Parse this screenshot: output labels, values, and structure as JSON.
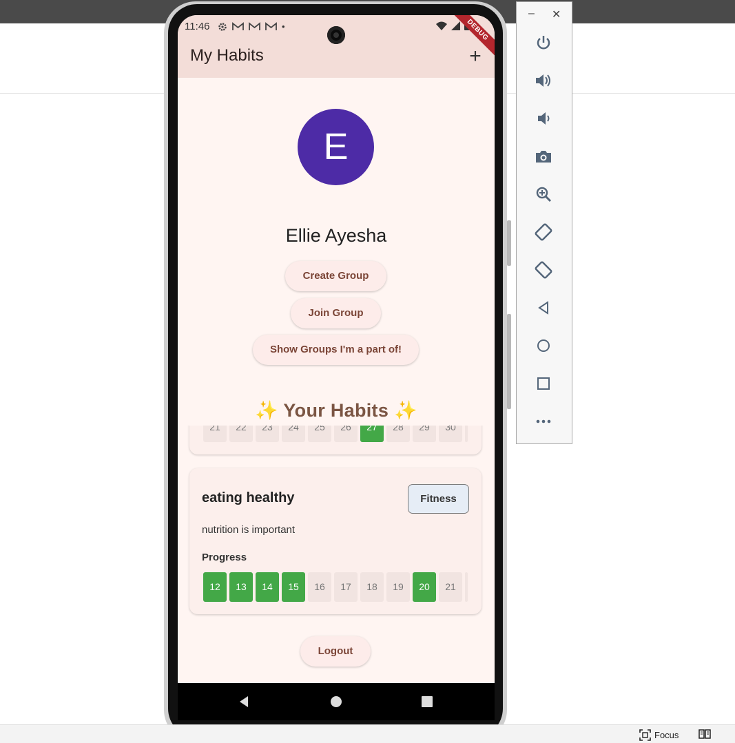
{
  "app": {
    "status_time": "11:46",
    "status_dot": "•",
    "debug_label": "DEBUG",
    "title": "My Habits",
    "add_icon": "+",
    "avatar_letter": "E",
    "user_name": "Ellie Ayesha",
    "buttons": {
      "create_group": "Create Group",
      "join_group": "Join Group",
      "show_groups": "Show Groups I'm a part of!",
      "logout": "Logout"
    },
    "habits_heading": "Your Habits",
    "habits": [
      {
        "days": [
          {
            "label": "21",
            "done": false
          },
          {
            "label": "22",
            "done": false
          },
          {
            "label": "23",
            "done": false
          },
          {
            "label": "24",
            "done": false
          },
          {
            "label": "25",
            "done": false
          },
          {
            "label": "26",
            "done": false
          },
          {
            "label": "27",
            "done": true
          },
          {
            "label": "28",
            "done": false
          },
          {
            "label": "29",
            "done": false
          },
          {
            "label": "30",
            "done": false
          }
        ]
      },
      {
        "title": "eating healthy",
        "category": "Fitness",
        "description": "nutrition is important",
        "progress_label": "Progress",
        "days": [
          {
            "label": "12",
            "done": true
          },
          {
            "label": "13",
            "done": true
          },
          {
            "label": "14",
            "done": true
          },
          {
            "label": "15",
            "done": true
          },
          {
            "label": "16",
            "done": false
          },
          {
            "label": "17",
            "done": false
          },
          {
            "label": "18",
            "done": false
          },
          {
            "label": "19",
            "done": false
          },
          {
            "label": "20",
            "done": true
          },
          {
            "label": "21",
            "done": false
          }
        ]
      }
    ]
  },
  "colors": {
    "appbar": "#f3ddd8",
    "background": "#fff5f2",
    "avatar": "#4d2ba6",
    "done_day": "#43a847",
    "heading": "#7b5543",
    "button_text": "#7b4537"
  },
  "icons": {
    "status": [
      "settings-icon",
      "gmail-icon",
      "gmail-icon",
      "gmail-icon"
    ],
    "status_right": [
      "wifi-icon",
      "signal-icon",
      "battery-icon"
    ],
    "nav": [
      "back-icon",
      "home-icon",
      "recents-icon"
    ],
    "toolbar": [
      "power-icon",
      "volume-up-icon",
      "volume-down-icon",
      "camera-icon",
      "zoom-icon",
      "rotate-left-icon",
      "rotate-right-icon",
      "back-icon",
      "home-icon",
      "overview-icon",
      "more-icon"
    ]
  },
  "taskbar": {
    "focus_label": "Focus"
  },
  "window": {
    "minimize": "–",
    "close": "✕"
  }
}
